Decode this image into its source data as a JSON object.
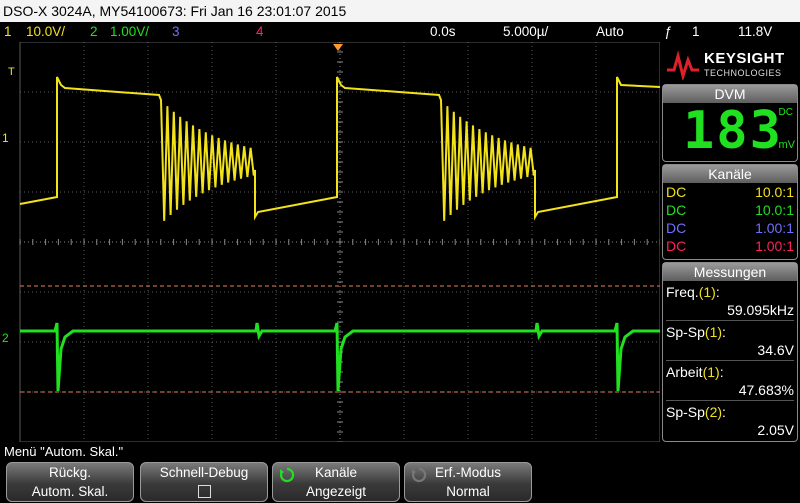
{
  "title_bar": {
    "text": "DSO-X 3024A, MY54100673: Fri Jan 16 23:01:07 2015"
  },
  "status_bar": {
    "ch1_num": "1",
    "ch1_scale": "10.0V/",
    "ch2_num": "2",
    "ch2_scale": "1.00V/",
    "ch3_num": "3",
    "ch4_num": "4",
    "delay": "0.0s",
    "timebase": "5.000µ/",
    "trigger_mode": "Auto",
    "trigger_icon": "ƒ",
    "trigger_source": "1",
    "trigger_level": "11.8V"
  },
  "colors": {
    "ch1": "#f2e21a",
    "ch2": "#20e020",
    "ch3": "#7070ff",
    "ch4": "#ff2060",
    "grid": "#5a5a5a",
    "cursor": "#e8805a",
    "trigger_marker": "#ff9a2a"
  },
  "screen": {
    "ch1_marker": "1",
    "ch2_marker": "2",
    "trigger_marker": "T"
  },
  "brand": {
    "name": "KEYSIGHT",
    "sub": "TECHNOLOGIES"
  },
  "dvm": {
    "header": "DVM",
    "value": "183",
    "mode": "DC",
    "unit": "mV"
  },
  "channels": {
    "header": "Kanäle",
    "rows": [
      {
        "coupling": "DC",
        "probe": "10.0:1",
        "color": "#f2e21a"
      },
      {
        "coupling": "DC",
        "probe": "10.0:1",
        "color": "#20e020"
      },
      {
        "coupling": "DC",
        "probe": "1.00:1",
        "color": "#7070ff"
      },
      {
        "coupling": "DC",
        "probe": "1.00:1",
        "color": "#ff2060"
      }
    ]
  },
  "measurements": {
    "header": "Messungen",
    "items": [
      {
        "label": "Freq.",
        "src": "(1)",
        "colon": ":",
        "value": "59.095kHz"
      },
      {
        "label": "Sp-Sp",
        "src": "(1)",
        "colon": ":",
        "value": "34.6V"
      },
      {
        "label": "Arbeit",
        "src": "(1)",
        "colon": ":",
        "value": "47.683%"
      },
      {
        "label": "Sp-Sp",
        "src": "(2)",
        "colon": ":",
        "value": "2.05V"
      }
    ]
  },
  "menu": {
    "text": "Menü \"Autom. Skal.\""
  },
  "softkeys": [
    {
      "line1": "Rückg.",
      "line2": "Autom. Skal."
    },
    {
      "line1": "Schnell-Debug",
      "line2": ""
    },
    {
      "line1": "Kanäle",
      "line2": "Angezeigt"
    },
    {
      "line1": "Erf.-Modus",
      "line2": "Normal"
    }
  ]
}
